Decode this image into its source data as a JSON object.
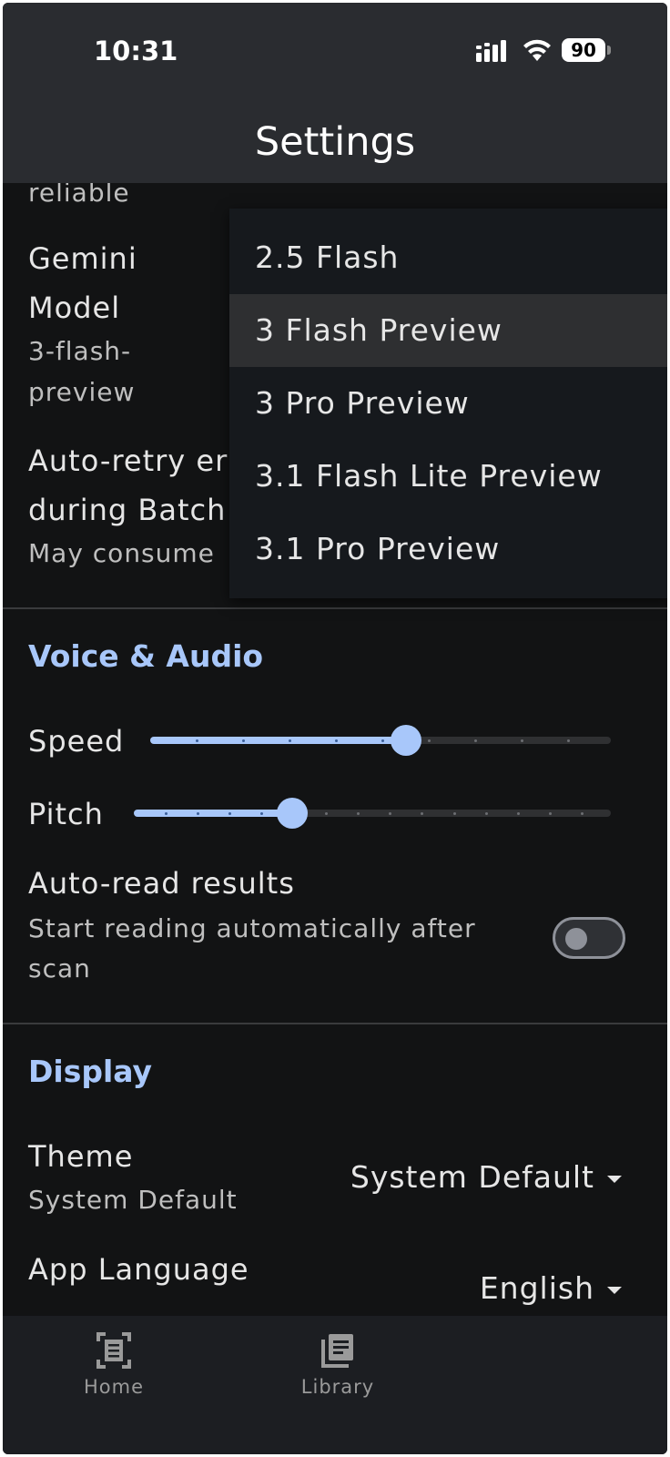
{
  "status_bar": {
    "time": "10:31",
    "battery": "90"
  },
  "app_bar": {
    "title": "Settings"
  },
  "settings": {
    "ai": {
      "truncated_text": "reliable",
      "gemini_model": {
        "label_line1": "Gemini",
        "label_line2": "Model",
        "value_line1": "3-flash-",
        "value_line2": "preview"
      },
      "auto_retry": {
        "label_line1": "Auto-retry er",
        "label_line2": "during Batch",
        "description": "May consume"
      }
    },
    "voice_audio": {
      "header": "Voice & Audio",
      "speed": {
        "label": "Speed",
        "value_fraction": 0.55,
        "steps": 10
      },
      "pitch": {
        "label": "Pitch",
        "value_fraction": 0.33,
        "steps": 15
      },
      "auto_read": {
        "label": "Auto-read results",
        "description_line1": "Start reading automatically after",
        "description_line2": "scan",
        "enabled": false
      }
    },
    "display": {
      "header": "Display",
      "theme": {
        "label": "Theme",
        "description": "System Default",
        "selected": "System Default"
      },
      "app_language": {
        "label": "App Language",
        "selected": "English"
      }
    }
  },
  "model_menu": {
    "options": [
      {
        "label": "2.5 Flash",
        "selected": false
      },
      {
        "label": "3 Flash Preview",
        "selected": true
      },
      {
        "label": "3 Pro Preview",
        "selected": false
      },
      {
        "label": "3.1 Flash Lite Preview",
        "selected": false
      },
      {
        "label": "3.1 Pro Preview",
        "selected": false
      }
    ]
  },
  "bottom_nav": {
    "items": [
      {
        "label": "Home",
        "icon": "document-scanner-icon"
      },
      {
        "label": "Library",
        "icon": "library-books-icon"
      }
    ]
  },
  "colors": {
    "accent": "#a8c7fa",
    "background": "#121314",
    "app_bar": "#2a2c30",
    "menu": "#16191d",
    "nav": "#1c1e22"
  }
}
